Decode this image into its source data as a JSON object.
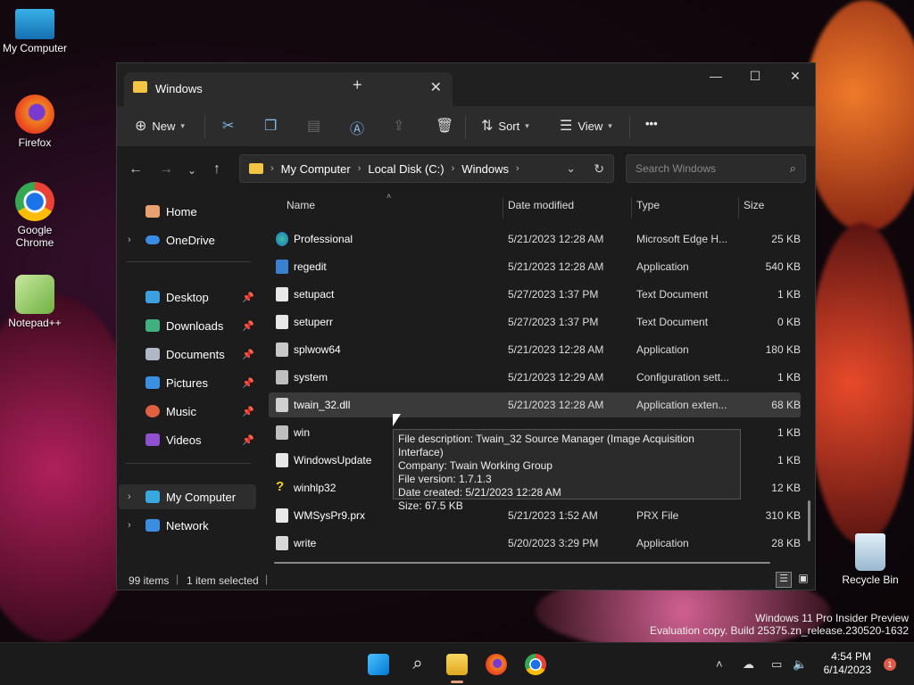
{
  "desktop": {
    "icons": [
      {
        "label": "My Computer"
      },
      {
        "label": "Firefox"
      },
      {
        "label": "Google Chrome"
      },
      {
        "label": "Notepad++"
      },
      {
        "label": "Recycle Bin"
      }
    ],
    "watermark": {
      "line1": "Windows 11 Pro Insider Preview",
      "line2": "Evaluation copy. Build 25375.zn_release.230520-1632"
    }
  },
  "window": {
    "tab_title": "Windows",
    "tab_close": "✕",
    "new_tab": "+",
    "controls": {
      "minimize": "—",
      "maximize": "☐",
      "close": "✕"
    }
  },
  "toolbar": {
    "new_label": "New",
    "sort_label": "Sort",
    "view_label": "View",
    "more_label": "•••"
  },
  "address": {
    "crumbs": [
      "My Computer",
      "Local Disk (C:)",
      "Windows"
    ],
    "search_placeholder": "Search Windows"
  },
  "sidebar": {
    "items": [
      {
        "label": "Home"
      },
      {
        "label": "OneDrive"
      },
      {
        "label": "Desktop"
      },
      {
        "label": "Downloads"
      },
      {
        "label": "Documents"
      },
      {
        "label": "Pictures"
      },
      {
        "label": "Music"
      },
      {
        "label": "Videos"
      },
      {
        "label": "My Computer"
      },
      {
        "label": "Network"
      }
    ]
  },
  "columns": {
    "name": "Name",
    "date": "Date modified",
    "type": "Type",
    "size": "Size"
  },
  "files": [
    {
      "name": "Professional",
      "date": "5/21/2023 12:28 AM",
      "type": "Microsoft Edge H...",
      "size": "25 KB"
    },
    {
      "name": "regedit",
      "date": "5/21/2023 12:28 AM",
      "type": "Application",
      "size": "540 KB"
    },
    {
      "name": "setupact",
      "date": "5/27/2023 1:37 PM",
      "type": "Text Document",
      "size": "1 KB"
    },
    {
      "name": "setuperr",
      "date": "5/27/2023 1:37 PM",
      "type": "Text Document",
      "size": "0 KB"
    },
    {
      "name": "splwow64",
      "date": "5/21/2023 12:28 AM",
      "type": "Application",
      "size": "180 KB"
    },
    {
      "name": "system",
      "date": "5/21/2023 12:29 AM",
      "type": "Configuration sett...",
      "size": "1 KB"
    },
    {
      "name": "twain_32.dll",
      "date": "5/21/2023 12:28 AM",
      "type": "Application exten...",
      "size": "68 KB"
    },
    {
      "name": "win",
      "date": "",
      "type": "",
      "size": "1 KB"
    },
    {
      "name": "WindowsUpdate",
      "date": "",
      "type": "",
      "size": "1 KB"
    },
    {
      "name": "winhlp32",
      "date": "",
      "type": "",
      "size": "12 KB"
    },
    {
      "name": "WMSysPr9.prx",
      "date": "5/21/2023 1:52 AM",
      "type": "PRX File",
      "size": "310 KB"
    },
    {
      "name": "write",
      "date": "5/20/2023 3:29 PM",
      "type": "Application",
      "size": "28 KB"
    }
  ],
  "tooltip": {
    "line1": "File description: Twain_32 Source Manager (Image Acquisition Interface)",
    "line2": "Company: Twain Working Group",
    "line3": "File version: 1.7.1.3",
    "line4": "Date created: 5/21/2023 12:28 AM",
    "line5": "Size: 67.5 KB"
  },
  "status": {
    "items": "99 items",
    "selected": "1 item selected"
  },
  "taskbar": {
    "time": "4:54 PM",
    "date": "6/14/2023",
    "badge": "1"
  }
}
